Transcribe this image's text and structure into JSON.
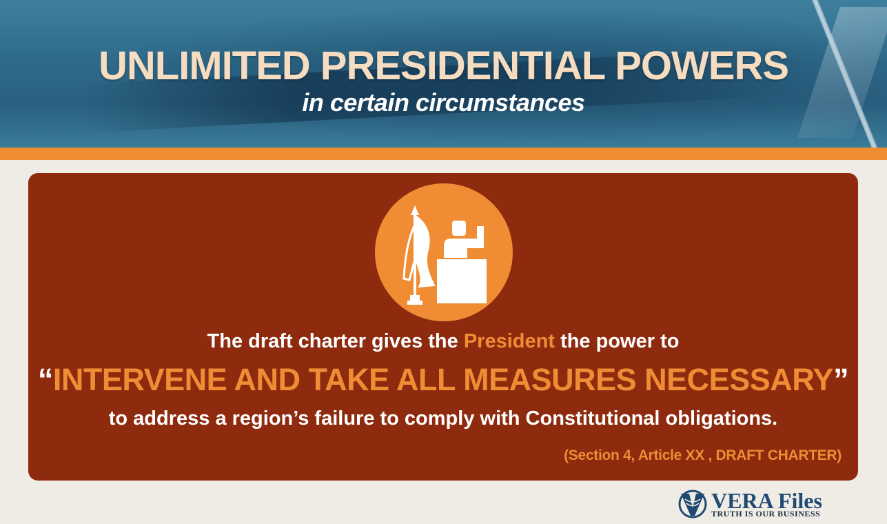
{
  "header": {
    "title": "UNLIMITED PRESIDENTIAL POWERS",
    "subtitle": "in certain circumstances"
  },
  "card": {
    "icon": "president-podium-flag-icon",
    "line1_before": "The draft charter gives the",
    "line1_highlight": "President",
    "line1_after": "the power to",
    "quote_open": "“",
    "quote_text": "INTERVENE AND TAKE ALL MEASURES NECESSARY",
    "quote_close": "”",
    "line3": "to address a region’s failure to comply with Constitutional obligations.",
    "citation": "(Section 4, Article XX , DRAFT CHARTER)"
  },
  "logo": {
    "name": "VERA Files",
    "tagline": "TRUTH IS OUR BUSINESS"
  },
  "colors": {
    "accent_orange": "#f08c34",
    "card_rust": "#8e2b0f",
    "title_cream": "#f6dcc0",
    "background": "#efece6",
    "logo_blue": "#1f4a72"
  }
}
